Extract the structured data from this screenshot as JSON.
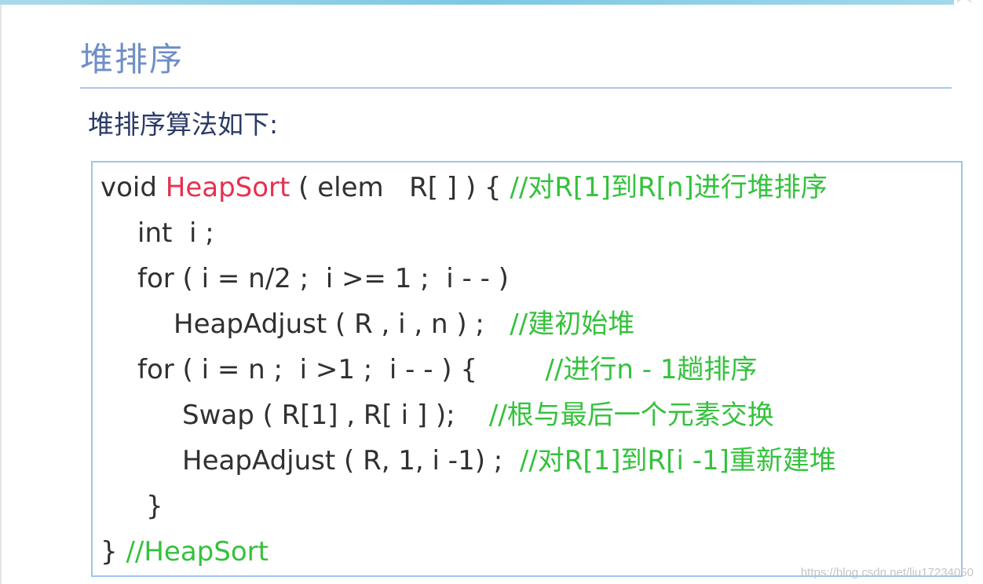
{
  "slide": {
    "title": "堆排序",
    "subtitle": "堆排序算法如下:"
  },
  "code": {
    "line1": {
      "prefix": "void ",
      "name": "HeapSort",
      "signature": " ( elem   R[ ] ) { ",
      "comment": "//对R[1]到R[n]进行堆排序"
    },
    "line2": {
      "text": "int  i ;"
    },
    "line3": {
      "text": "for ( i = n/2 ;  i >= 1 ;  i - - )"
    },
    "line4": {
      "text": "HeapAdjust ( R , i , n ) ;   ",
      "comment": "//建初始堆"
    },
    "line5": {
      "text": "for ( i = n ;  i >1 ;  i - - ) {        ",
      "comment": "//进行n - 1趟排序"
    },
    "line6": {
      "text": "Swap ( R[1] , R[ i ] );    ",
      "comment": "//根与最后一个元素交换"
    },
    "line7": {
      "text": "HeapAdjust ( R, 1, i -1) ;  ",
      "comment": "//对R[1]到R[i -1]重新建堆"
    },
    "line8": {
      "text": "}"
    },
    "line9": {
      "text": "} ",
      "comment": "//HeapSort"
    }
  },
  "watermark": "https://blog.csdn.net/liu17234050",
  "colors": {
    "title": "#6e8ec6",
    "function_name": "#e7304f",
    "comment": "#34c23c",
    "box_border": "#9fc3ec"
  }
}
